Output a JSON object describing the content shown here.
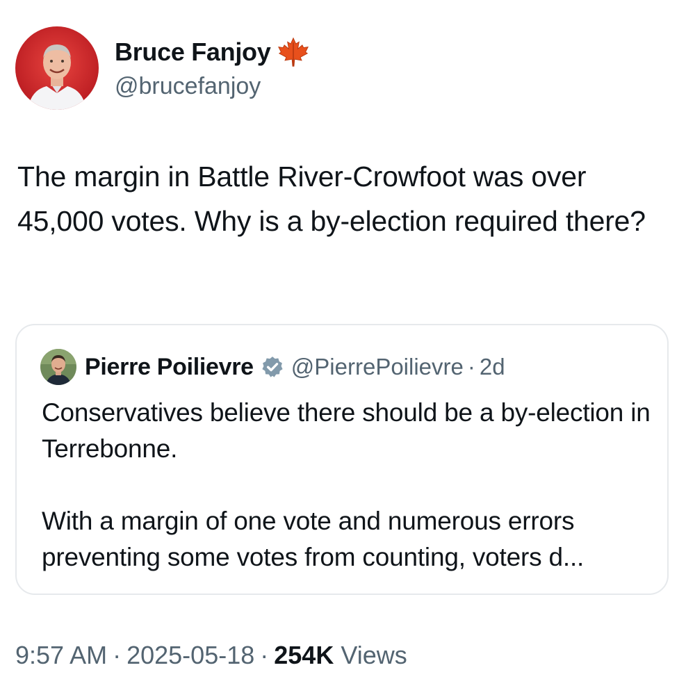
{
  "author": {
    "name": "Bruce Fanjoy",
    "handle": "@brucefanjoy",
    "badge_icon": "maple-leaf-icon"
  },
  "tweet": {
    "text": "The margin in Battle River-Crowfoot was over 45,000 votes. Why is a by-election required there?"
  },
  "quote": {
    "name": "Pierre Poilievre",
    "verified_icon": "verified-badge-icon",
    "handle": "@PierrePoilievre",
    "separator": "·",
    "time": "2d",
    "paragraphs": [
      "Conservatives believe there should be a by-election in Terrebonne.",
      "With a margin of one vote and numerous errors preventing some votes from counting, voters d..."
    ]
  },
  "meta": {
    "time": "9:57 AM",
    "date": "2025-05-18",
    "separator": "·",
    "views_count": "254K",
    "views_label": "Views"
  },
  "colors": {
    "text": "#0f1419",
    "secondary": "#536471",
    "border": "#e6e9ec",
    "avatar_bg": "#d6252b",
    "verified": "#829aab"
  }
}
